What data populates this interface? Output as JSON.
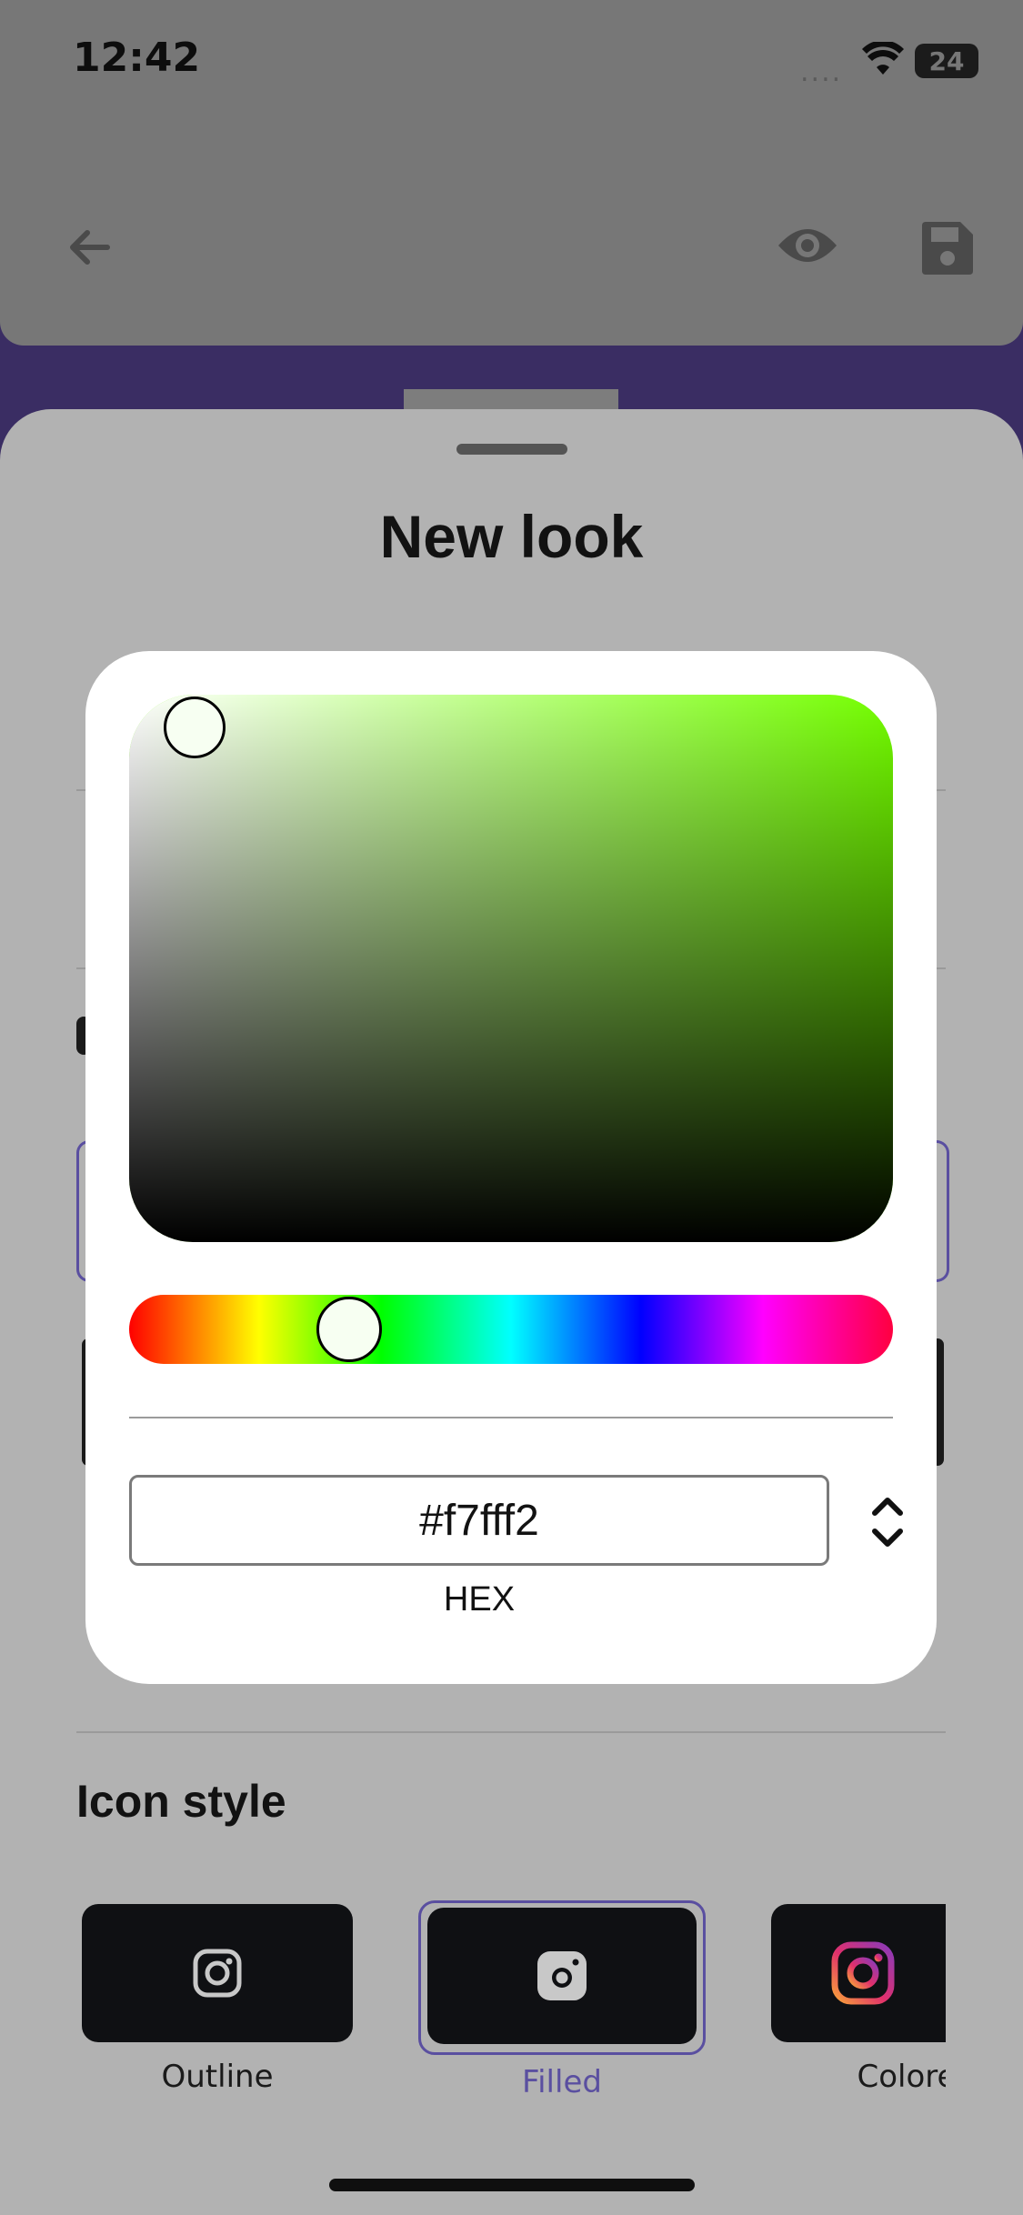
{
  "status_bar": {
    "time": "12:42",
    "signal_dots": "....",
    "battery": "24"
  },
  "header": {
    "back_icon": "arrow-left-icon",
    "preview_icon": "eye-icon",
    "save_icon": "floppy-disk-icon"
  },
  "sheet": {
    "title": "New look"
  },
  "color_picker": {
    "hex_value": "#f7fff2",
    "format_label": "HEX",
    "hue_color": "#74ff00",
    "thumb_color": "#f7fff2"
  },
  "icon_style": {
    "title": "Icon style",
    "options": [
      {
        "label": "Outline",
        "icon": "instagram-outline-icon",
        "selected": false
      },
      {
        "label": "Filled",
        "icon": "instagram-filled-icon",
        "selected": true
      },
      {
        "label": "Colore",
        "icon": "instagram-colored-icon",
        "selected": false
      }
    ]
  },
  "colors": {
    "accent": "#5a4fa0",
    "backdrop": "#3a2d63"
  }
}
